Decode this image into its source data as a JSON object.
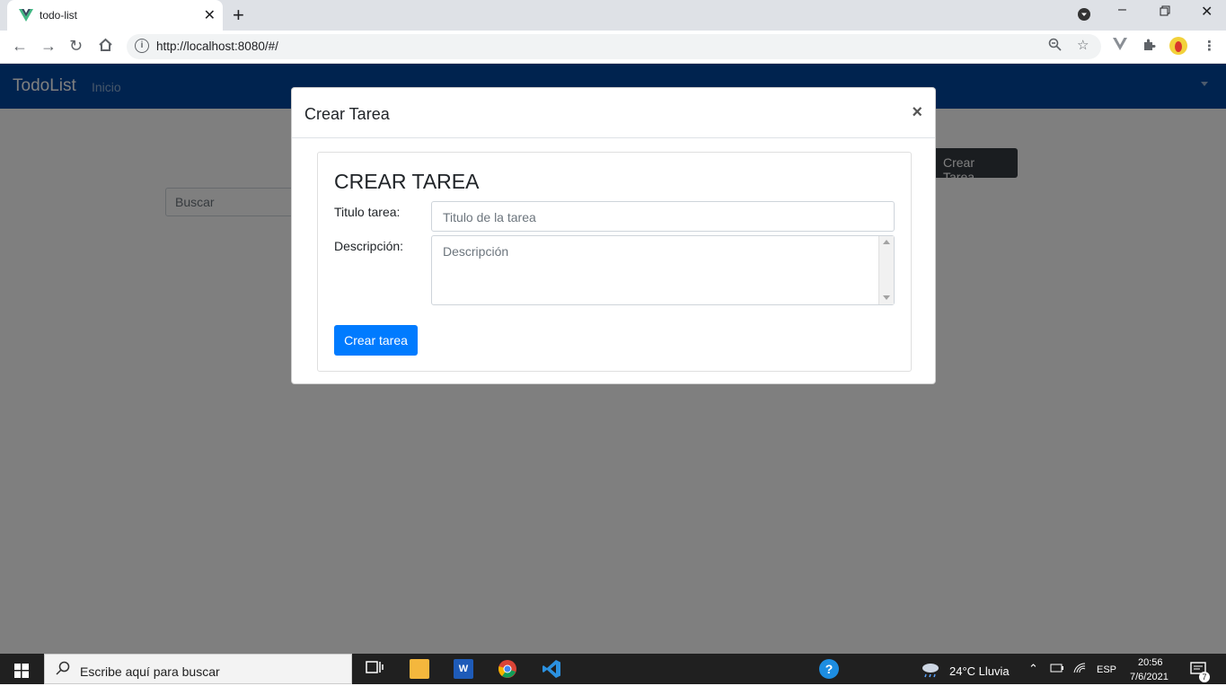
{
  "browser": {
    "tab_title": "todo-list",
    "tab_close": "✕",
    "new_tab": "+",
    "url": "http://localhost:8080/#/"
  },
  "app": {
    "brand": "TodoList",
    "nav_link": "Inicio",
    "search_placeholder": "Buscar",
    "crear_button": "Crear Tarea"
  },
  "modal": {
    "title": "Crear Tarea",
    "close": "×",
    "heading": "CREAR TAREA",
    "titulo_label": "Titulo tarea:",
    "titulo_placeholder": "Titulo de la tarea",
    "descripcion_label": "Descripción:",
    "descripcion_placeholder": "Descripción",
    "submit": "Crear tarea"
  },
  "taskbar": {
    "search_placeholder": "Escribe aquí para buscar",
    "weather": "24°C  Lluvia",
    "lang": "ESP",
    "time": "20:56",
    "date": "7/6/2021",
    "notif_count": "7"
  },
  "colors": {
    "navbar": "#00479e",
    "primary": "#007bff"
  }
}
